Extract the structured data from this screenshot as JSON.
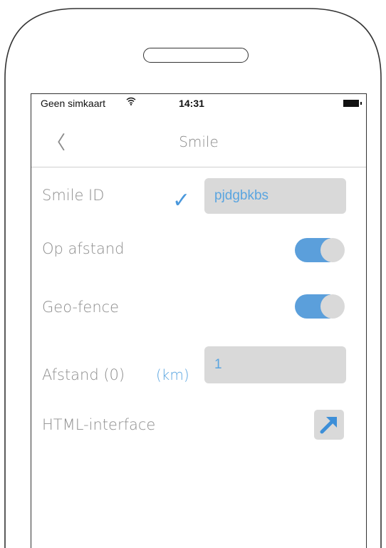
{
  "status_bar": {
    "carrier": "Geen simkaart",
    "wifi_icon": "wifi-icon",
    "time": "14:31",
    "battery_icon": "battery-icon"
  },
  "nav": {
    "back_glyph": "〈",
    "title": "Smile"
  },
  "rows": {
    "smile_id": {
      "label": "Smile ID",
      "status_icon": "checkmark-icon",
      "value": "pjdgbkbs"
    },
    "op_afstand": {
      "label": "Op afstand",
      "enabled": true
    },
    "geo_fence": {
      "label": "Geo-fence",
      "enabled": true
    },
    "afstand": {
      "label": "Afstand (0)",
      "unit": "(km)",
      "value": "1"
    },
    "html_interface": {
      "label": "HTML-interface",
      "button_icon": "external-arrow-icon"
    }
  },
  "colors": {
    "accent": "#5b9fdb",
    "field_bg": "#d9d9d9",
    "label_text": "#8e8e8e"
  }
}
